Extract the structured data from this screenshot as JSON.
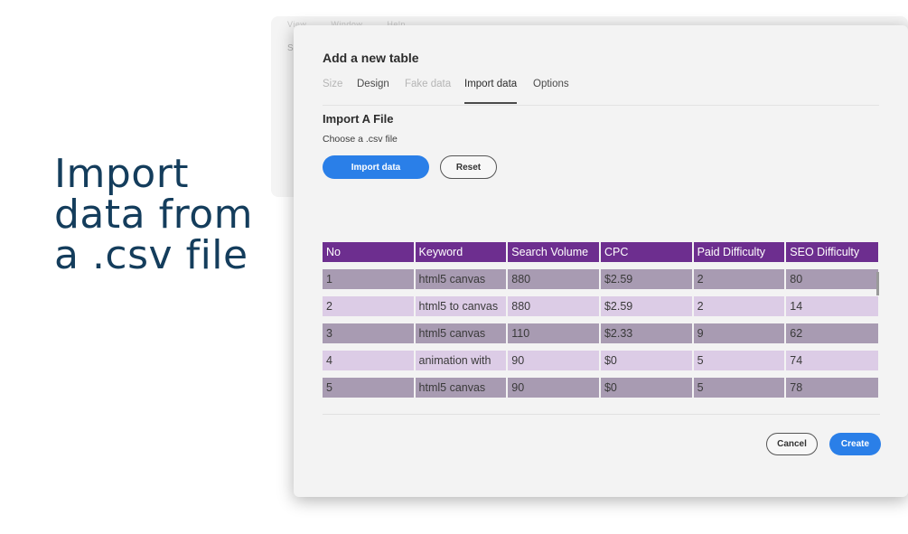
{
  "background": {
    "menu": [
      "View",
      "Window",
      "Help"
    ],
    "side_letter": "S"
  },
  "headline": [
    "Import",
    "data from",
    "a .csv file"
  ],
  "dialog": {
    "title": "Add a new table",
    "tabs": [
      {
        "label": "Size",
        "state": "disabled"
      },
      {
        "label": "Design",
        "state": "normal"
      },
      {
        "label": "Fake data",
        "state": "disabled"
      },
      {
        "label": "Import data",
        "state": "active"
      },
      {
        "label": "Options",
        "state": "normal"
      }
    ],
    "section_title": "Import A File",
    "section_subtitle": "Choose a .csv file",
    "import_button": "Import data",
    "reset_button": "Reset",
    "table": {
      "columns": [
        "No",
        "Keyword",
        "Search Volume",
        "CPC",
        "Paid Difficulty",
        "SEO Difficulty"
      ],
      "rows": [
        [
          "1",
          "html5 canvas",
          "880",
          "$2.59",
          "2",
          "80"
        ],
        [
          "2",
          "html5 to canvas",
          "880",
          "$2.59",
          "2",
          "14"
        ],
        [
          "3",
          "html5 canvas",
          "110",
          "$2.33",
          "9",
          "62"
        ],
        [
          "4",
          "animation with",
          "90",
          "$0",
          "5",
          "74"
        ],
        [
          "5",
          "html5 canvas",
          "90",
          "$0",
          "5",
          "78"
        ]
      ]
    },
    "cancel_button": "Cancel",
    "create_button": "Create"
  },
  "colors": {
    "header_purple": "#6d2e8f",
    "row_dark": "#a89bb2",
    "row_light": "#dccce6",
    "primary_blue": "#2a7fe8",
    "headline_navy": "#143d5c"
  }
}
